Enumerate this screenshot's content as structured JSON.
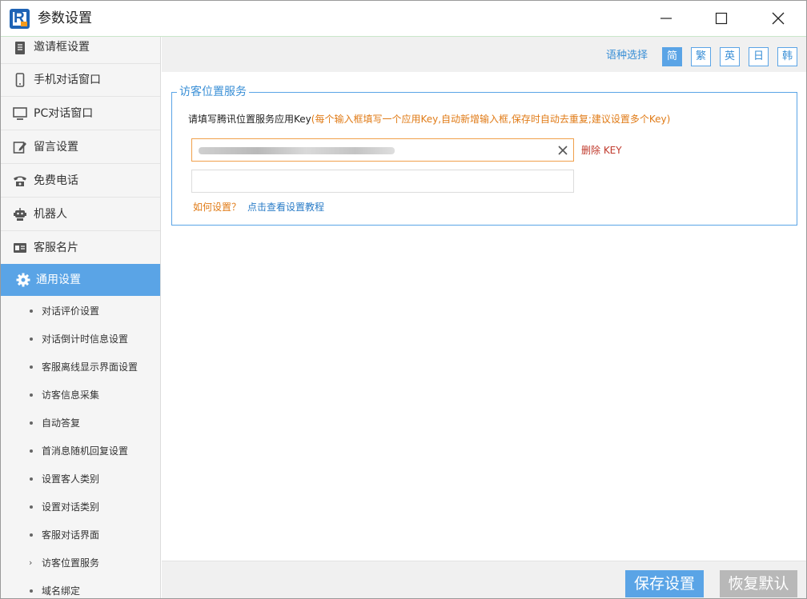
{
  "window": {
    "title": "参数设置",
    "logo_letter": "R"
  },
  "sidebar": {
    "items": [
      {
        "label": "邀请框设置",
        "icon": "book-icon"
      },
      {
        "label": "手机对话窗口",
        "icon": "mobile-phone-icon"
      },
      {
        "label": "PC对话窗口",
        "icon": "monitor-icon"
      },
      {
        "label": "留言设置",
        "icon": "note-edit-icon"
      },
      {
        "label": "免费电话",
        "icon": "telephone-icon"
      },
      {
        "label": "机器人",
        "icon": "robot-icon"
      },
      {
        "label": "客服名片",
        "icon": "id-card-icon"
      },
      {
        "label": "通用设置",
        "icon": "gear-icon",
        "active": true
      }
    ],
    "sub_items": [
      {
        "label": "对话评价设置"
      },
      {
        "label": "对话倒计时信息设置"
      },
      {
        "label": "客服离线显示界面设置"
      },
      {
        "label": "访客信息采集"
      },
      {
        "label": "自动答复"
      },
      {
        "label": "首消息随机回复设置"
      },
      {
        "label": "设置客人类别"
      },
      {
        "label": "设置对话类别"
      },
      {
        "label": "客服对话界面"
      },
      {
        "label": "访客位置服务",
        "current": true
      },
      {
        "label": "域名绑定"
      }
    ]
  },
  "language": {
    "label": "语种选择",
    "options": [
      {
        "label": "简",
        "active": true
      },
      {
        "label": "繁"
      },
      {
        "label": "英"
      },
      {
        "label": "日"
      },
      {
        "label": "韩"
      }
    ]
  },
  "section": {
    "legend": "访客位置服务",
    "instruction": "请填写腾讯位置服务应用Key",
    "hint": "(每个输入框填写一个应用Key,自动新增输入框,保存时自动去重复;建议设置多个Key)",
    "delete_label": "删除 KEY",
    "help_question": "如何设置？",
    "help_link": "点击查看设置教程"
  },
  "footer": {
    "save_label": "保存设置",
    "reset_label": "恢复默认"
  },
  "colors": {
    "accent": "#5aa4e6",
    "link": "#2a7cc7",
    "hint": "#e07b17",
    "danger": "#c0392b",
    "disabled": "#b8b8b8"
  }
}
